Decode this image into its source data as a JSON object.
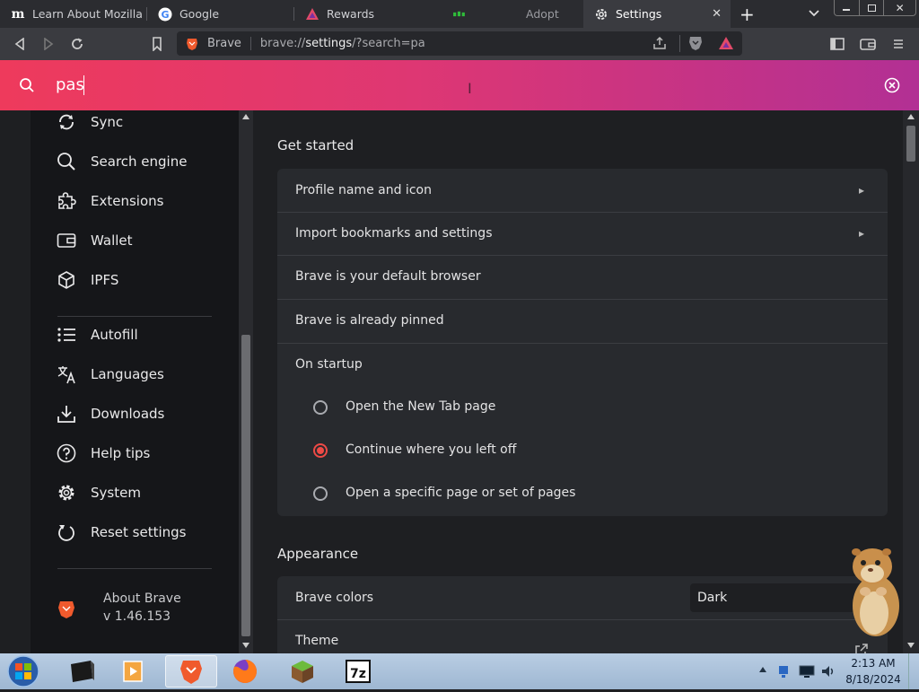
{
  "tabs": [
    {
      "title": "Learn About Mozilla —",
      "favicon": "mozilla-m-icon"
    },
    {
      "title": "Google",
      "favicon": "google-g-icon"
    },
    {
      "title": "Rewards",
      "favicon": "brave-rewards-icon"
    },
    {
      "title": "Adopt",
      "favicon": "green-icon"
    },
    {
      "title": "Settings",
      "favicon": "gear-icon",
      "active": true
    }
  ],
  "toolbar": {
    "site_label": "Brave",
    "url_prefix": "brave://",
    "url_host": "settings",
    "url_rest": "/?search=pa"
  },
  "search": {
    "value": "pas"
  },
  "sidebar": {
    "items": [
      {
        "label": "Sync",
        "icon": "sync-icon"
      },
      {
        "label": "Search engine",
        "icon": "search-icon"
      },
      {
        "label": "Extensions",
        "icon": "puzzle-icon"
      },
      {
        "label": "Wallet",
        "icon": "wallet-icon"
      },
      {
        "label": "IPFS",
        "icon": "cube-icon"
      },
      {
        "label": "Autofill",
        "icon": "list-icon"
      },
      {
        "label": "Languages",
        "icon": "translate-icon"
      },
      {
        "label": "Downloads",
        "icon": "download-icon"
      },
      {
        "label": "Help tips",
        "icon": "help-icon"
      },
      {
        "label": "System",
        "icon": "gear-icon"
      },
      {
        "label": "Reset settings",
        "icon": "reset-icon"
      }
    ],
    "about": {
      "title": "About Brave",
      "version": "v 1.46.153"
    }
  },
  "main": {
    "get_started": {
      "title": "Get started",
      "rows": [
        {
          "label": "Profile name and icon"
        },
        {
          "label": "Import bookmarks and settings"
        },
        {
          "label": "Brave is your default browser"
        },
        {
          "label": "Brave is already pinned"
        },
        {
          "label": "On startup"
        }
      ],
      "startup_options": [
        {
          "label": "Open the New Tab page",
          "selected": false
        },
        {
          "label": "Continue where you left off",
          "selected": true
        },
        {
          "label": "Open a specific page or set of pages",
          "selected": false
        }
      ]
    },
    "appearance": {
      "title": "Appearance",
      "brave_colors_label": "Brave colors",
      "brave_colors_value": "Dark",
      "theme_label": "Theme"
    }
  },
  "taskbar": {
    "time": "2:13 AM",
    "date": "8/18/2024"
  },
  "colors": {
    "accent": "#ee3a5c",
    "radio_selected": "#ee4a46"
  }
}
